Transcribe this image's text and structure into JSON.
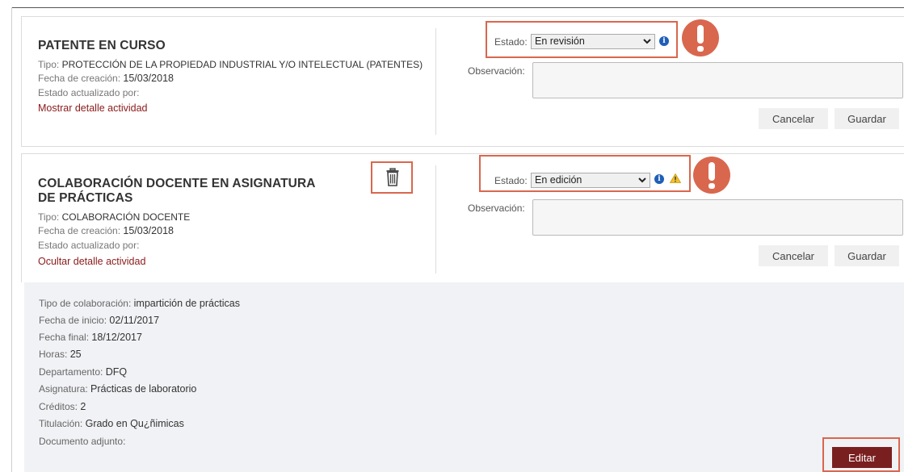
{
  "estado_label": "Estado:",
  "observacion_label": "Observación:",
  "cancel_label": "Cancelar",
  "save_label": "Guardar",
  "tipo_label": "Tipo:",
  "fecha_creacion_label": "Fecha de creación:",
  "estado_actualizado_label": "Estado actualizado por:",
  "accent_color": "#d9674e",
  "link_color": "#8b1a1a",
  "activities": [
    {
      "title": "PATENTE EN CURSO",
      "tipo": "PROTECCIÓN DE LA PROPIEDAD INDUSTRIAL Y/O INTELECTUAL (PATENTES)",
      "fecha_creacion": "15/03/2018",
      "toggle_label": "Mostrar detalle actividad",
      "estado_value": "En revisión",
      "icons": [
        "info-icon",
        "alert-icon"
      ]
    },
    {
      "title_line1": "COLABORACIÓN DOCENTE EN ASIGNATURA",
      "title_line2": "DE PRÁCTICAS",
      "tipo": "COLABORACIÓN DOCENTE",
      "fecha_creacion": "15/03/2018",
      "toggle_label": "Ocultar detalle actividad",
      "estado_value": "En edición",
      "icons": [
        "trash-icon",
        "info-icon",
        "warning-icon",
        "alert-icon"
      ]
    }
  ],
  "detail": {
    "rows": [
      {
        "label": "Tipo de colaboración:",
        "value": "impartición de prácticas"
      },
      {
        "label": "Fecha de inicio:",
        "value": "02/11/2017"
      },
      {
        "label": "Fecha final:",
        "value": "18/12/2017"
      },
      {
        "label": "Horas:",
        "value": "25"
      },
      {
        "label": "Departamento:",
        "value": "DFQ"
      },
      {
        "label": "Asignatura:",
        "value": "Prácticas de laboratorio"
      },
      {
        "label": "Créditos:",
        "value": "2"
      },
      {
        "label": "Titulación:",
        "value": "Grado en Qu¿ñimicas"
      },
      {
        "label": "Documento adjunto:",
        "value": ""
      }
    ],
    "edit_label": "Editar"
  }
}
